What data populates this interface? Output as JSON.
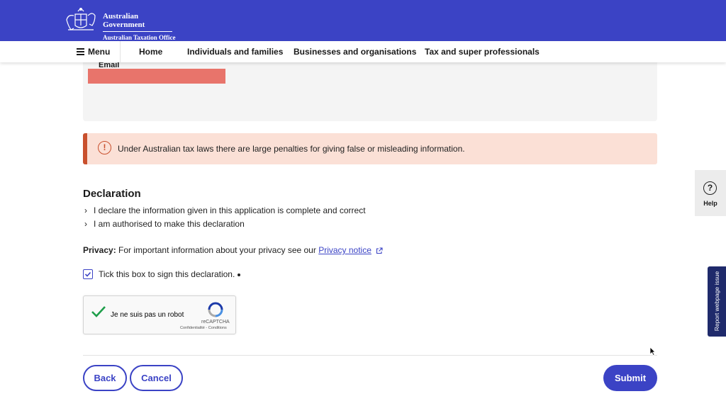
{
  "header": {
    "gov_line1": "Australian Government",
    "gov_line2": "Australian Taxation Office",
    "brand_color": "#3b43c5"
  },
  "nav": {
    "menu_label": "Menu",
    "items": [
      "Home",
      "Individuals and families",
      "Businesses and organisations",
      "Tax and super professionals"
    ]
  },
  "form": {
    "email_label": "Email",
    "warning_text": "Under Australian tax laws there are large penalties for giving false or misleading information.",
    "declaration": {
      "title": "Declaration",
      "items": [
        "I declare the information given in this application is complete and correct",
        "I am authorised to make this declaration"
      ]
    },
    "privacy": {
      "label": "Privacy:",
      "text": "For important information about your privacy see our",
      "link": "Privacy notice"
    },
    "sign_checkbox": {
      "label": "Tick this box to sign this declaration.",
      "checked": true
    },
    "captcha": {
      "label": "Je ne suis pas un robot",
      "brand": "reCAPTCHA",
      "links": "Confidentialité - Conditions",
      "checked": true
    },
    "buttons": {
      "back": "Back",
      "cancel": "Cancel",
      "submit": "Submit"
    }
  },
  "side": {
    "help_label": "Help",
    "report_label": "Report webpage issue"
  },
  "colors": {
    "warning_bg": "#fbe0d6",
    "warning_border": "#c9502d",
    "report_tab": "#1f2a6b"
  }
}
